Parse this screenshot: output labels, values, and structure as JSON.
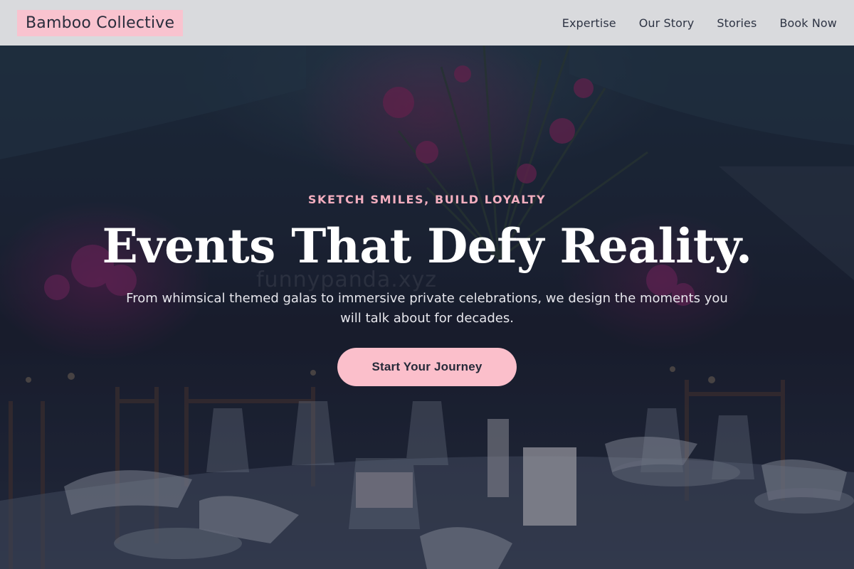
{
  "navbar": {
    "brand": "Bamboo Collective",
    "links": [
      "Expertise",
      "Our Story",
      "Stories",
      "Book Now"
    ]
  },
  "hero": {
    "eyebrow": "SKETCH SMILES, BUILD LOYALTY",
    "headline": "Events That Defy Reality.",
    "subtext": "From whimsical themed galas to immersive private celebrations, we design the moments you will talk about for decades.",
    "cta_label": "Start Your Journey",
    "watermark": "funnypanda.xyz",
    "background_image": "dim banquet table with floral centerpiece, glassware, candles and chairs"
  },
  "colors": {
    "navbar_bg": "#d9dadd",
    "brand_bg": "#f9c3cf",
    "accent_pink": "#f3aebf",
    "cta_bg": "#fbbfcb",
    "text_dark": "#2e3444"
  }
}
